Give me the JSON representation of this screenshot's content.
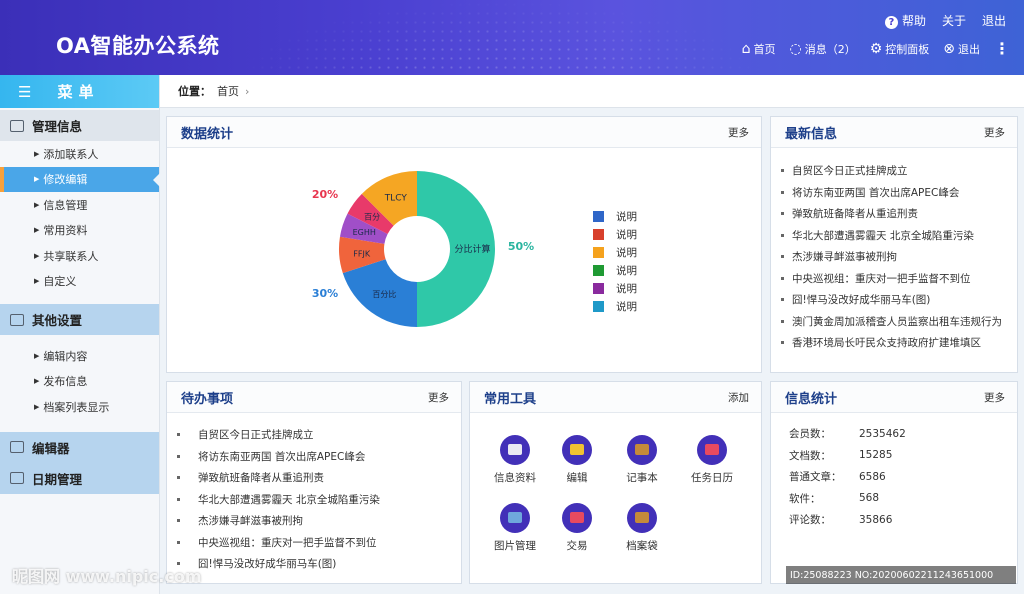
{
  "app": {
    "title": "OA智能办公系统"
  },
  "toplinks": {
    "help": "帮助",
    "about": "关于",
    "logout": "退出"
  },
  "topnav": {
    "home": "首页",
    "messages": "消息（2）",
    "control_panel": "控制面板",
    "exit": "退出"
  },
  "sidebar": {
    "menu_title": "菜单",
    "sections": [
      {
        "title": "管理信息",
        "icon": "list-icon"
      },
      {
        "title": "其他设置",
        "icon": "chat-icon"
      },
      {
        "title": "编辑器",
        "icon": "edit-icon"
      },
      {
        "title": "日期管理",
        "icon": "calendar-icon"
      }
    ],
    "group1": [
      "添加联系人",
      "修改编辑",
      "信息管理",
      "常用资料",
      "共享联系人",
      "自定义"
    ],
    "group2": [
      "编辑内容",
      "发布信息",
      "档案列表显示"
    ],
    "active_item": "修改编辑"
  },
  "breadcrumb": {
    "label": "位置：",
    "current": "首页"
  },
  "panels": {
    "stats": {
      "title": "数据统计",
      "more": "更多"
    },
    "news": {
      "title": "最新信息",
      "more": "更多"
    },
    "todo": {
      "title": "待办事项",
      "more": "更多"
    },
    "tools": {
      "title": "常用工具",
      "more": "添加"
    },
    "info": {
      "title": "信息统计",
      "more": "更多"
    }
  },
  "news_items": [
    "自贸区今日正式挂牌成立",
    "将访东南亚两国 首次出席APEC峰会",
    "弹致航班备降者从重追刑责",
    "华北大部遭遇雾霾天 北京全城陷重污染",
    "杰涉嫌寻衅滋事被刑拘",
    "中央巡视组：重庆对一把手监督不到位",
    "囧!悍马没改好成华丽马车(图)",
    "澳门黄金周加派稽查人员监察出租车违规行为",
    "香港环境局长吁民众支持政府扩建堆填区"
  ],
  "todo_items": [
    "自贸区今日正式挂牌成立",
    "将访东南亚两国 首次出席APEC峰会",
    "弹致航班备降者从重追刑责",
    "华北大部遭遇雾霾天 北京全城陷重污染",
    "杰涉嫌寻衅滋事被刑拘",
    "中央巡视组：重庆对一把手监督不到位",
    "囧!悍马没改好成华丽马车(图)"
  ],
  "tools": [
    {
      "label": "信息资料",
      "icon": "document-icon"
    },
    {
      "label": "编辑",
      "icon": "pencil-icon"
    },
    {
      "label": "记事本",
      "icon": "notebook-icon"
    },
    {
      "label": "任务日历",
      "icon": "calendar-icon"
    },
    {
      "label": "图片管理",
      "icon": "image-icon"
    },
    {
      "label": "交易",
      "icon": "shop-icon"
    },
    {
      "label": "档案袋",
      "icon": "envelope-icon"
    }
  ],
  "info_stats": [
    {
      "key": "会员数：",
      "value": "2535462"
    },
    {
      "key": "文档数：",
      "value": "15285"
    },
    {
      "key": "普通文章：",
      "value": "6586"
    },
    {
      "key": "软件：",
      "value": "568"
    },
    {
      "key": "评论数：",
      "value": "35866"
    }
  ],
  "legend": [
    {
      "label": "说明",
      "color": "#2f66c8"
    },
    {
      "label": "说明",
      "color": "#d8402c"
    },
    {
      "label": "说明",
      "color": "#f5a21d"
    },
    {
      "label": "说明",
      "color": "#1f9a33"
    },
    {
      "label": "说明",
      "color": "#8a2a9e"
    },
    {
      "label": "说明",
      "color": "#1f99c8"
    }
  ],
  "chart_data": {
    "type": "pie",
    "segments": [
      {
        "label": "分比计算",
        "value": 50,
        "color": "#2fc8a8"
      },
      {
        "label": "百分比",
        "value": 20,
        "color": "#2a7fd6"
      },
      {
        "label": "FFJK",
        "value": 7.5,
        "color": "#f0643c"
      },
      {
        "label": "EGHH",
        "value": 5,
        "color": "#a04fc8"
      },
      {
        "label": "百分",
        "value": 5,
        "color": "#e83a6a"
      },
      {
        "label": "TLCY",
        "value": 12.5,
        "color": "#f5a623"
      }
    ],
    "outer_labels": [
      {
        "text": "50%",
        "color": "#2bb5a0"
      },
      {
        "text": "20%",
        "color": "#e8364f"
      },
      {
        "text": "30%",
        "color": "#2a7fd6"
      }
    ]
  },
  "watermark": "昵图网 www.nipic.com",
  "image_id": "ID:25088223 NO:20200602211243651000"
}
